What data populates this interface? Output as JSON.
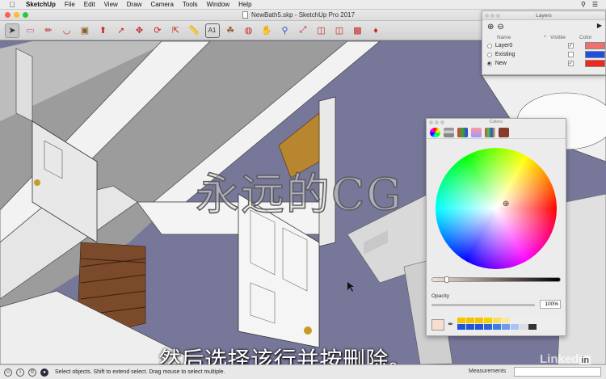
{
  "menubar": {
    "app": "SketchUp",
    "items": [
      "File",
      "Edit",
      "View",
      "Draw",
      "Camera",
      "Tools",
      "Window",
      "Help"
    ]
  },
  "window": {
    "title": "NewBath5.skp - SketchUp Pro 2017"
  },
  "toolbar": {
    "icons": [
      "select-icon",
      "eraser-icon",
      "line-icon",
      "arc-icon",
      "rectangle-icon",
      "push-pull-icon",
      "follow-me-icon",
      "move-icon",
      "rotate-icon",
      "scale-icon",
      "tape-measure-icon",
      "text-icon",
      "paint-bucket-icon",
      "orbit-icon",
      "pan-icon",
      "zoom-icon",
      "zoom-extents-icon",
      "3d-warehouse-icon",
      "extension-warehouse-icon",
      "layout-icon",
      "ruby-icon"
    ]
  },
  "layers_panel": {
    "title": "Layers",
    "headers": {
      "name": "Name",
      "visible": "Visible",
      "color": "Color"
    },
    "rows": [
      {
        "name": "Layer0",
        "visible": true,
        "current": false,
        "color": "#f07070"
      },
      {
        "name": "Existing",
        "visible": false,
        "current": false,
        "color": "#1f4fe0"
      },
      {
        "name": "New",
        "visible": true,
        "current": true,
        "color": "#ef2a1d"
      }
    ]
  },
  "colors_panel": {
    "title": "Colors",
    "opacity_label": "Opacity",
    "opacity_value": "100%",
    "current_color": "#f5ddd0"
  },
  "overlay": {
    "watermark": "永远的CG",
    "subtitle": "然后选择该行并按删除。",
    "brand": "Linked",
    "brand_in": "in"
  },
  "statusbar": {
    "hint": "Select objects. Shift to extend select. Drag mouse to select multiple.",
    "measurements_label": "Measurements"
  }
}
